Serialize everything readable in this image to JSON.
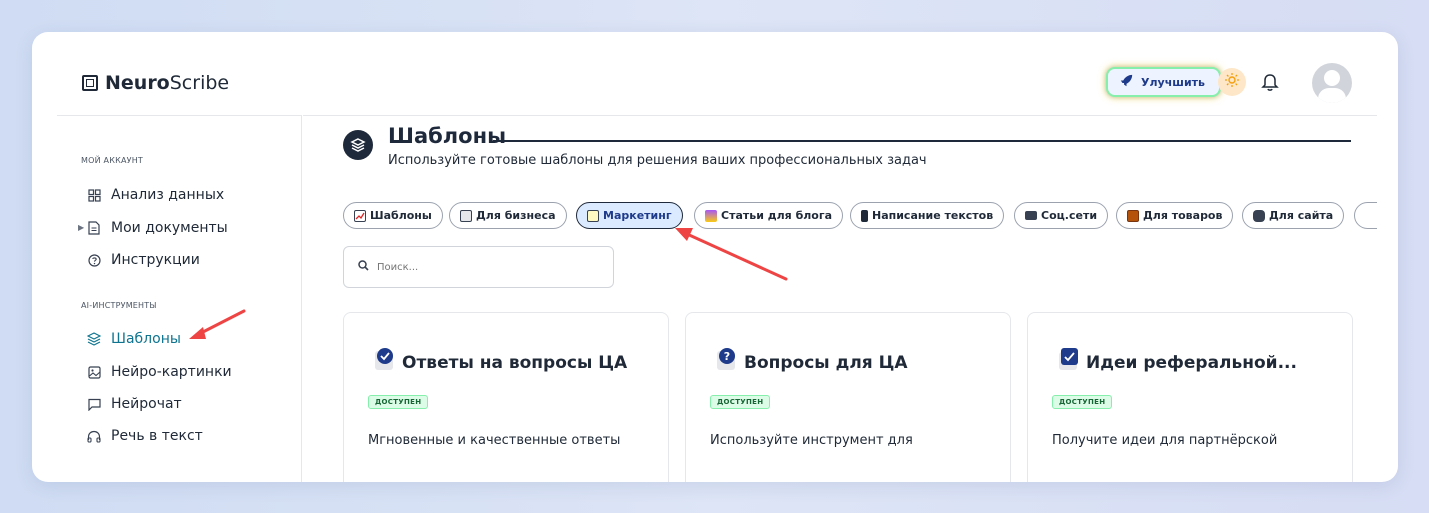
{
  "app": {
    "logo_bold": "Neuro",
    "logo_regular": "Scribe"
  },
  "header": {
    "upgrade_label": "Улучшить",
    "icons": [
      "rocket-icon",
      "sun-icon",
      "bell-icon",
      "avatar"
    ]
  },
  "sidebar": {
    "section_account": "МОЙ АККАУНТ",
    "account_items": [
      {
        "label": "Анализ данных",
        "icon": "grid-icon"
      },
      {
        "label": "Мои документы",
        "icon": "document-icon"
      },
      {
        "label": "Инструкции",
        "icon": "help-circle-icon"
      }
    ],
    "section_ai": "AI-ИНСТРУМЕНТЫ",
    "ai_items": [
      {
        "label": "Шаблоны",
        "icon": "layers-icon",
        "active": true
      },
      {
        "label": "Нейро-картинки",
        "icon": "image-icon"
      },
      {
        "label": "Нейрочат",
        "icon": "chat-icon"
      },
      {
        "label": "Речь в текст",
        "icon": "headphones-icon"
      }
    ]
  },
  "main": {
    "title": "Шаблоны",
    "subtitle": "Используйте готовые шаблоны для решения ваших профессиональных задач",
    "chips": [
      {
        "label": "Шаблоны",
        "icon": "chart-check-icon"
      },
      {
        "label": "Для бизнеса",
        "icon": "notebook-icon"
      },
      {
        "label": "Маркетинг",
        "icon": "memo-icon",
        "active": true
      },
      {
        "label": "Статьи для блога",
        "icon": "city-icon"
      },
      {
        "label": "Написание текстов",
        "icon": "phone-icon"
      },
      {
        "label": "Соц.сети",
        "icon": "laptop-icon"
      },
      {
        "label": "Для товаров",
        "icon": "ledger-icon"
      },
      {
        "label": "Для сайта",
        "icon": "robot-icon"
      }
    ],
    "search_placeholder": "Поиск...",
    "cards": [
      {
        "title": "Ответы на вопросы ЦА",
        "badge": "ДОСТУПЕН",
        "description": "Мгновенные и качественные ответы",
        "icon": "check-badge-icon"
      },
      {
        "title": "Вопросы для ЦА",
        "badge": "ДОСТУПЕН",
        "description": "Используйте инструмент для",
        "icon": "question-badge-icon"
      },
      {
        "title": "Идеи реферальной...",
        "badge": "ДОСТУПЕН",
        "description": "Получите идеи для партнёрской",
        "icon": "checkbox-icon"
      }
    ]
  },
  "colors": {
    "accent_active": "#0e7490",
    "dark": "#1e293b",
    "badge_bg": "#dcfce7",
    "arrow": "#ef4444"
  }
}
